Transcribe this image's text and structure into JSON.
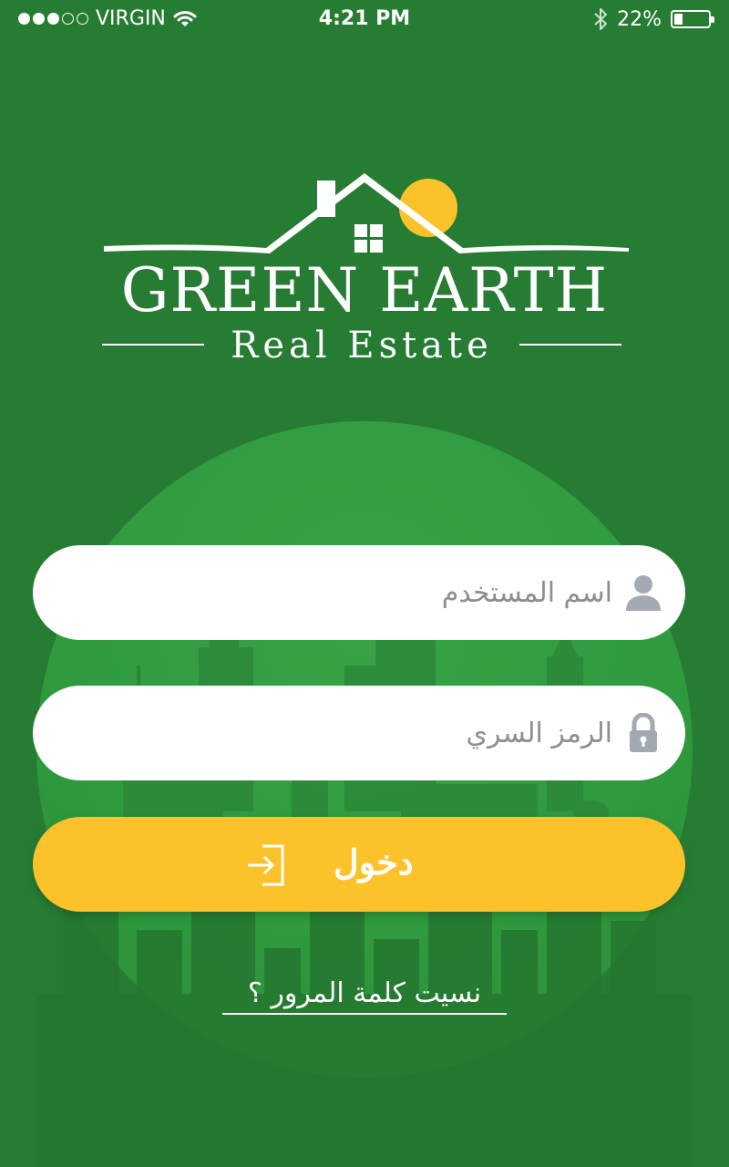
{
  "status_bar": {
    "carrier": "VIRGIN",
    "time": "4:21 PM",
    "battery": "22%",
    "battery_level": 0.22,
    "signal_bars_filled": 3,
    "signal_bars_total": 5
  },
  "logo": {
    "name": "GREEN EARTH",
    "tagline": "Real Estate"
  },
  "form": {
    "username_placeholder": "اسم المستخدم",
    "password_placeholder": "الرمز السري",
    "login_label": "دخول",
    "forgot_password": "نسيت كلمة المرور ؟"
  },
  "colors": {
    "background": "#277c33",
    "circle": "#34a043",
    "button": "#fbc22a",
    "field_icon": "#a3a9b3"
  }
}
